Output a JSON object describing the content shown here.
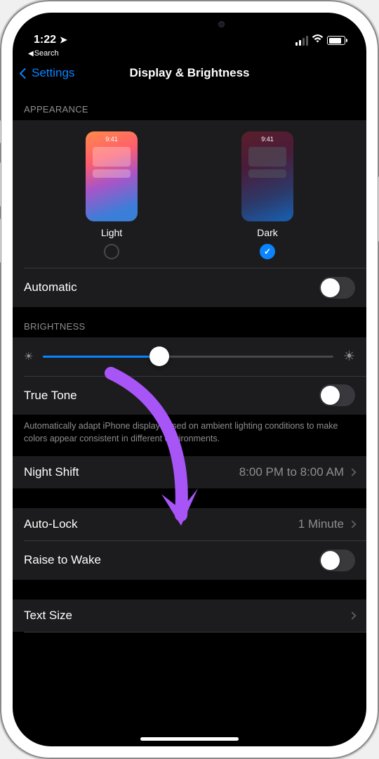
{
  "status": {
    "time": "1:22",
    "back_app": "Search"
  },
  "nav": {
    "back_label": "Settings",
    "title": "Display & Brightness"
  },
  "sections": {
    "appearance_header": "APPEARANCE",
    "brightness_header": "BRIGHTNESS"
  },
  "appearance": {
    "light_label": "Light",
    "dark_label": "Dark",
    "thumb_time": "9:41",
    "selected": "dark",
    "automatic_label": "Automatic",
    "automatic_on": false
  },
  "brightness": {
    "slider_value": 40,
    "truetone_label": "True Tone",
    "truetone_on": false,
    "truetone_footer": "Automatically adapt iPhone display based on ambient lighting conditions to make colors appear consistent in different environments."
  },
  "nightshift": {
    "label": "Night Shift",
    "value": "8:00 PM to 8:00 AM"
  },
  "autolock": {
    "label": "Auto-Lock",
    "value": "1 Minute"
  },
  "raise": {
    "label": "Raise to Wake",
    "on": false
  },
  "textsize": {
    "label": "Text Size"
  },
  "annotation": {
    "color": "#a855f7"
  }
}
